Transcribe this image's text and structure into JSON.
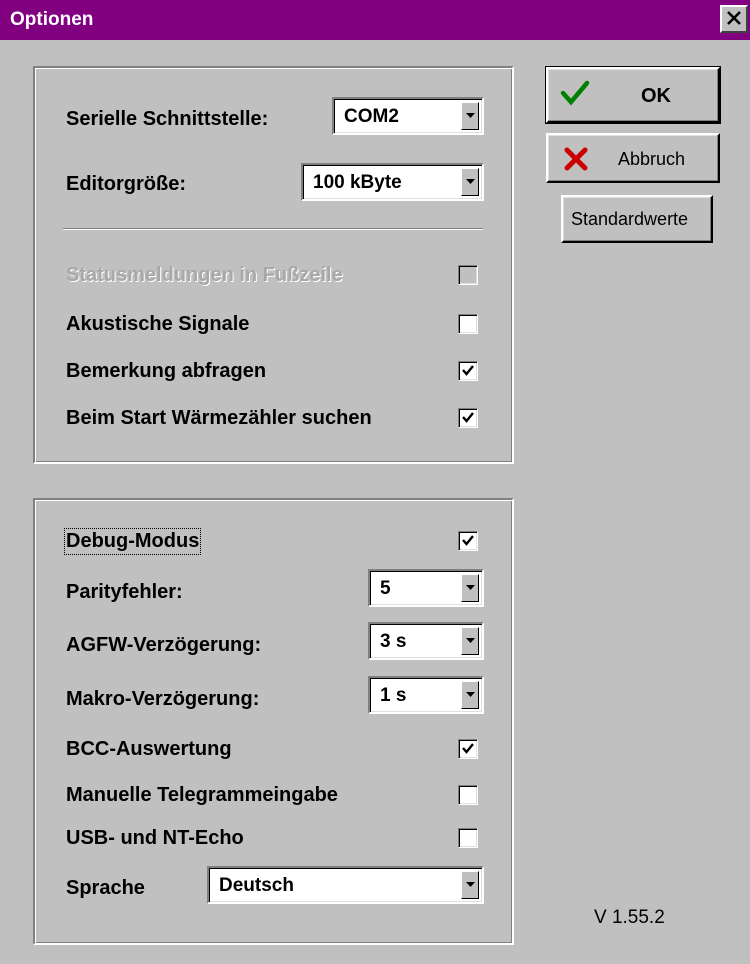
{
  "window": {
    "title": "Optionen"
  },
  "buttons": {
    "ok": "OK",
    "cancel": "Abbruch",
    "defaults": "Standardwerte"
  },
  "settings": {
    "serial_port": {
      "label": "Serielle Schnittstelle:",
      "value": "COM2"
    },
    "editor_size": {
      "label": "Editorgröße:",
      "value": "100 kByte"
    },
    "status_messages": {
      "label": "Statusmeldungen in Fußzeile",
      "checked": false,
      "disabled": true
    },
    "acoustic_signals": {
      "label": "Akustische Signale",
      "checked": false
    },
    "ask_remark": {
      "label": "Bemerkung abfragen",
      "checked": true
    },
    "search_heat_meter": {
      "label": "Beim Start Wärmezähler suchen",
      "checked": true
    }
  },
  "debug": {
    "debug_mode": {
      "label": "Debug-Modus",
      "checked": true
    },
    "parity_errors": {
      "label": "Parityfehler:",
      "value": "5"
    },
    "agfw_delay": {
      "label": "AGFW-Verzögerung:",
      "value": "3 s"
    },
    "macro_delay": {
      "label": "Makro-Verzögerung:",
      "value": "1 s"
    },
    "bcc_evaluation": {
      "label": "BCC-Auswertung",
      "checked": true
    },
    "manual_telegram": {
      "label": "Manuelle Telegrammeingabe",
      "checked": false
    },
    "usb_nt_echo": {
      "label": "USB- und NT-Echo",
      "checked": false
    },
    "language": {
      "label": "Sprache",
      "value": "Deutsch"
    }
  },
  "version": "V 1.55.2",
  "colors": {
    "titlebar": "#800080",
    "face": "#c0c0c0"
  }
}
